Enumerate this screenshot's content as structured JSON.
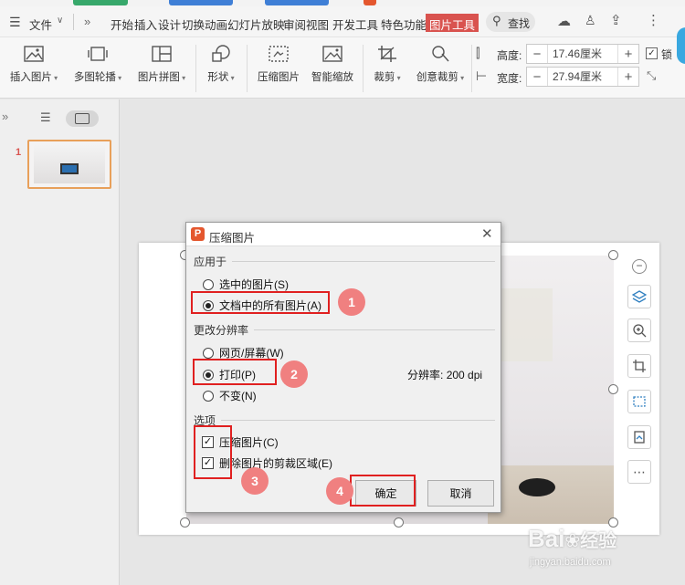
{
  "menubar": {
    "file_label": "文件",
    "tabs": [
      "开始",
      "插入",
      "设计",
      "切换",
      "动画",
      "幻灯片放映",
      "审阅",
      "视图",
      "开发工具",
      "特色功能"
    ],
    "active_tab": "图片工具",
    "search_label": "查找"
  },
  "ribbon": {
    "insert_picture": "插入图片",
    "multi_carousel": "多图轮播",
    "picture_collage": "图片拼图",
    "shape": "形状",
    "compress": "压缩图片",
    "smart_zoom": "智能缩放",
    "crop": "裁剪",
    "creative_crop": "创意裁剪",
    "height_label": "高度:",
    "height_value": "17.46厘米",
    "width_label": "宽度:",
    "width_value": "27.94厘米",
    "lock_label": "锁"
  },
  "sidebar": {
    "slide_number": "1"
  },
  "dialog": {
    "title": "压缩图片",
    "apply_section": "应用于",
    "apply_selected": "选中的图片(S)",
    "apply_all": "文档中的所有图片(A)",
    "resolution_section": "更改分辨率",
    "res_web": "网页/屏幕(W)",
    "res_print": "打印(P)",
    "res_none": "不变(N)",
    "resolution_label": "分辨率:",
    "resolution_value": "200 dpi",
    "options_section": "选项",
    "opt_compress": "压缩图片(C)",
    "opt_delete_crop": "删除图片的剪裁区域(E)",
    "ok": "确定",
    "cancel": "取消"
  },
  "annotations": [
    "1",
    "2",
    "3",
    "4"
  ],
  "watermark": {
    "brand": "Bai",
    "brand2": "经验",
    "url": "jingyan.baidu.com"
  },
  "colors": {
    "accent": "#d9534f",
    "active_tab_bg": "#d9534f",
    "annotation_red": "#e02020",
    "badge": "#f08080"
  }
}
